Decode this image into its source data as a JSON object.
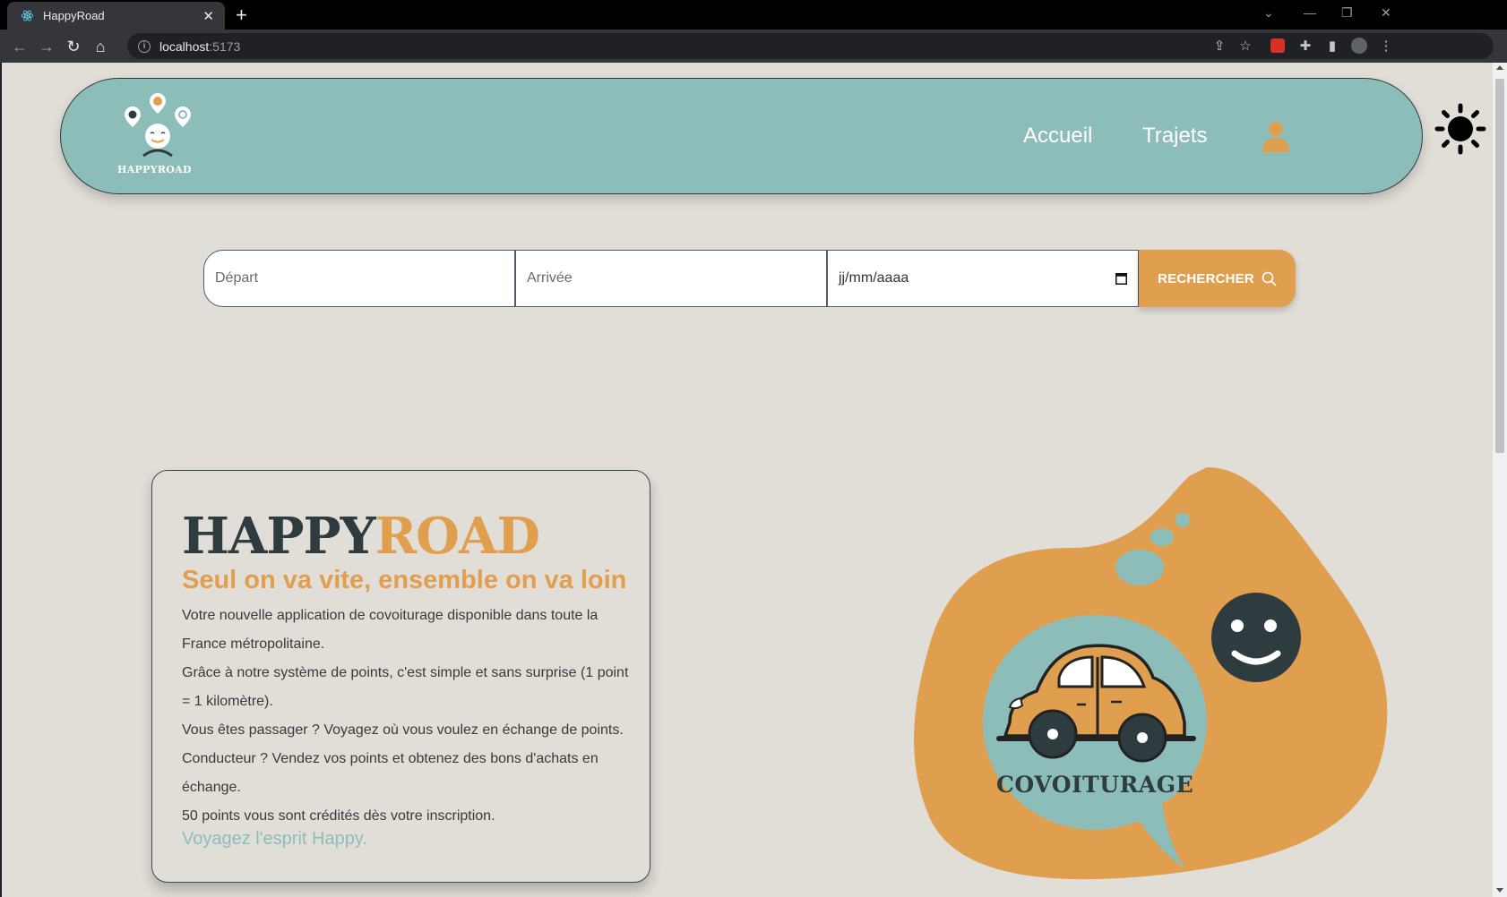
{
  "browser": {
    "tab_title": "HappyRoad",
    "url_host": "localhost",
    "url_port": ":5173"
  },
  "header": {
    "logo_text": "HAPPYROAD",
    "nav": [
      {
        "label": "Accueil"
      },
      {
        "label": "Trajets"
      }
    ]
  },
  "search": {
    "depart_placeholder": "Départ",
    "arrivee_placeholder": "Arrivée",
    "date_placeholder": "jj/mm/aaaa",
    "button_label": "RECHERCHER"
  },
  "intro": {
    "brand_part1": "HAPPY",
    "brand_part2": "ROAD",
    "tagline": "Seul on va vite, ensemble on va loin",
    "paragraphs": [
      "Votre nouvelle application de covoiturage disponible dans toute la France métropolitaine.",
      "Grâce à notre système de points, c'est simple et sans surprise (1 point = 1 kilomètre).",
      "Vous êtes passager ? Voyagez où vous voulez en échange de points.",
      "Conducteur ? Vendez vos points et obtenez des bons d'achats en échange.",
      "50 points vous sont crédités dès votre inscription."
    ],
    "closing": "Voyagez l'esprit Happy."
  },
  "illustration": {
    "label": "COVOITURAGE"
  },
  "colors": {
    "teal": "#8dbdb9",
    "orange": "#e09e4f",
    "dark": "#2f3c3f",
    "background": "#e1ddd7"
  }
}
